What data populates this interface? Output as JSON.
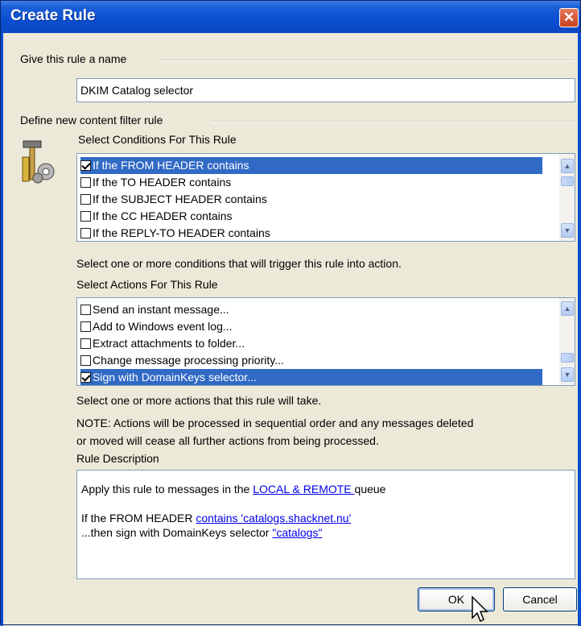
{
  "window": {
    "title": "Create Rule"
  },
  "name_section": {
    "label": "Give this rule a name",
    "value": "DKIM Catalog selector"
  },
  "filter_section": {
    "label": "Define new content filter rule"
  },
  "conditions": {
    "label": "Select Conditions For This Rule",
    "items": [
      {
        "label": "If the FROM HEADER contains",
        "checked": true,
        "selected": true
      },
      {
        "label": "If the TO HEADER contains",
        "checked": false,
        "selected": false
      },
      {
        "label": "If the SUBJECT HEADER contains",
        "checked": false,
        "selected": false
      },
      {
        "label": "If the CC HEADER contains",
        "checked": false,
        "selected": false
      },
      {
        "label": "If the REPLY-TO HEADER contains",
        "checked": false,
        "selected": false
      }
    ],
    "hint": "Select one or more conditions that will trigger this rule into action."
  },
  "actions": {
    "label": "Select Actions For This Rule",
    "items": [
      {
        "label": "Send an instant message...",
        "checked": false,
        "selected": false
      },
      {
        "label": "Add to Windows event log...",
        "checked": false,
        "selected": false
      },
      {
        "label": "Extract attachments to folder...",
        "checked": false,
        "selected": false
      },
      {
        "label": "Change message processing priority...",
        "checked": false,
        "selected": false
      },
      {
        "label": "Sign with DomainKeys selector...",
        "checked": true,
        "selected": true
      }
    ],
    "hint": "Select one or more actions that this rule will take.",
    "note_line1": "NOTE:  Actions will be processed in sequential order and any messages deleted",
    "note_line2": "or moved will cease all further actions from being processed."
  },
  "description": {
    "label": "Rule Description",
    "line1_prefix": "Apply this rule to messages in the ",
    "line1_link": "LOCAL & REMOTE ",
    "line1_suffix": " queue",
    "line2_prefix": "If the FROM HEADER ",
    "line2_link": "contains 'catalogs.shacknet.nu'",
    "line3_prefix": "...then sign with DomainKeys selector ",
    "line3_link": "\"catalogs\""
  },
  "buttons": {
    "ok": "OK",
    "cancel": "Cancel"
  },
  "colors": {
    "titlebar": "#0a4ed0",
    "selection": "#316ac5",
    "link": "#0000ee",
    "face": "#ece9d8"
  }
}
